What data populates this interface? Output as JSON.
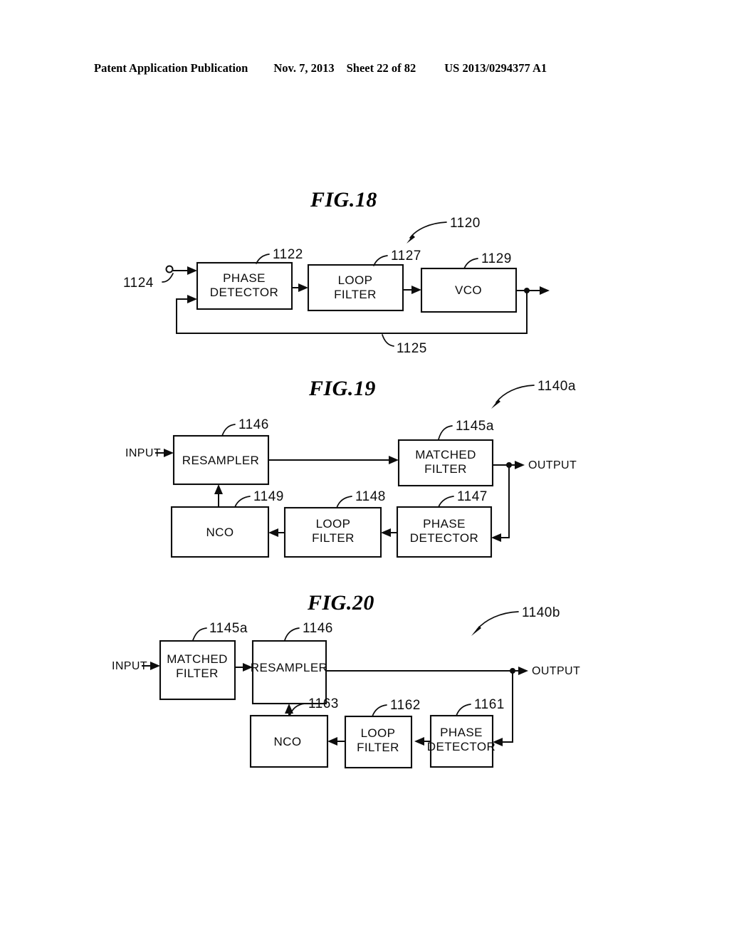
{
  "header": {
    "publication": "Patent Application Publication",
    "date": "Nov. 7, 2013",
    "sheet": "Sheet 22 of 82",
    "patent_number": "US 2013/0294377 A1"
  },
  "figures": [
    {
      "id": "fig18",
      "title": "FIG.18",
      "system_ref": "1120",
      "blocks": [
        {
          "key": "phase_detector",
          "label_line1": "PHASE",
          "label_line2": "DETECTOR",
          "ref": "1122"
        },
        {
          "key": "loop_filter",
          "label_line1": "LOOP",
          "label_line2": "FILTER",
          "ref": "1127"
        },
        {
          "key": "vco",
          "label_line1": "VCO",
          "label_line2": "",
          "ref": "1129"
        }
      ],
      "signals": [
        {
          "key": "input_terminal",
          "label": "1124"
        },
        {
          "key": "feedback_path",
          "label": "1125"
        }
      ]
    },
    {
      "id": "fig19",
      "title": "FIG.19",
      "system_ref": "1140a",
      "blocks": [
        {
          "key": "resampler",
          "label_line1": "RESAMPLER",
          "label_line2": "",
          "ref": "1146"
        },
        {
          "key": "matched_filter",
          "label_line1": "MATCHED",
          "label_line2": "FILTER",
          "ref": "1145a"
        },
        {
          "key": "nco",
          "label_line1": "NCO",
          "label_line2": "",
          "ref": "1149"
        },
        {
          "key": "loop_filter",
          "label_line1": "LOOP",
          "label_line2": "FILTER",
          "ref": "1148"
        },
        {
          "key": "phase_detector",
          "label_line1": "PHASE",
          "label_line2": "DETECTOR",
          "ref": "1147"
        }
      ],
      "io": {
        "input": "INPUT",
        "output": "OUTPUT"
      }
    },
    {
      "id": "fig20",
      "title": "FIG.20",
      "system_ref": "1140b",
      "blocks": [
        {
          "key": "matched_filter",
          "label_line1": "MATCHED",
          "label_line2": "FILTER",
          "ref": "1145a"
        },
        {
          "key": "resampler",
          "label_line1": "RESAMPLER",
          "label_line2": "",
          "ref": "1146"
        },
        {
          "key": "nco",
          "label_line1": "NCO",
          "label_line2": "",
          "ref": "1163"
        },
        {
          "key": "loop_filter",
          "label_line1": "LOOP",
          "label_line2": "FILTER",
          "ref": "1162"
        },
        {
          "key": "phase_detector",
          "label_line1": "PHASE",
          "label_line2": "DETECTOR",
          "ref": "1161"
        }
      ],
      "io": {
        "input": "INPUT",
        "output": "OUTPUT"
      }
    }
  ]
}
